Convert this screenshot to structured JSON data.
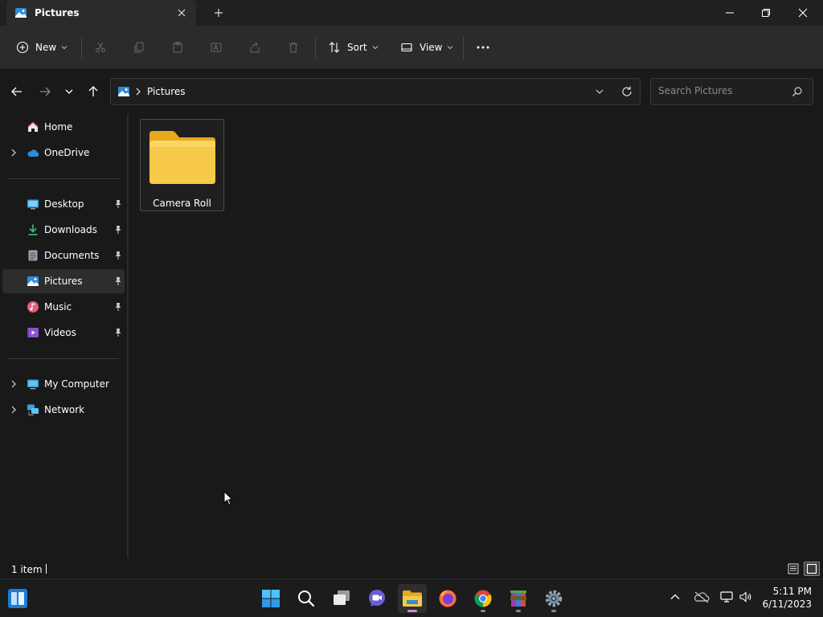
{
  "window": {
    "tab_title": "Pictures"
  },
  "toolbar": {
    "new_label": "New",
    "sort_label": "Sort",
    "view_label": "View"
  },
  "address": {
    "location": "Pictures",
    "search_placeholder": "Search Pictures"
  },
  "sidebar": {
    "items": [
      {
        "label": "Home",
        "icon": "home-icon"
      },
      {
        "label": "OneDrive",
        "icon": "cloud-icon"
      },
      {
        "label": "Desktop",
        "icon": "desktop-icon",
        "pinned": true
      },
      {
        "label": "Downloads",
        "icon": "download-icon",
        "pinned": true
      },
      {
        "label": "Documents",
        "icon": "document-icon",
        "pinned": true
      },
      {
        "label": "Pictures",
        "icon": "pictures-icon",
        "pinned": true,
        "selected": true
      },
      {
        "label": "Music",
        "icon": "music-icon",
        "pinned": true
      },
      {
        "label": "Videos",
        "icon": "video-icon",
        "pinned": true
      },
      {
        "label": "My Computer",
        "icon": "computer-icon"
      },
      {
        "label": "Network",
        "icon": "network-icon"
      }
    ]
  },
  "content": {
    "items": [
      {
        "name": "Camera Roll",
        "type": "folder"
      }
    ]
  },
  "status": {
    "item_count": "1 item"
  },
  "taskbar": {
    "time": "5:11 PM",
    "date": "6/11/2023"
  },
  "colors": {
    "folder_yellow": "#f7c948",
    "accent_blue": "#4cc2ff",
    "background": "#191919"
  }
}
